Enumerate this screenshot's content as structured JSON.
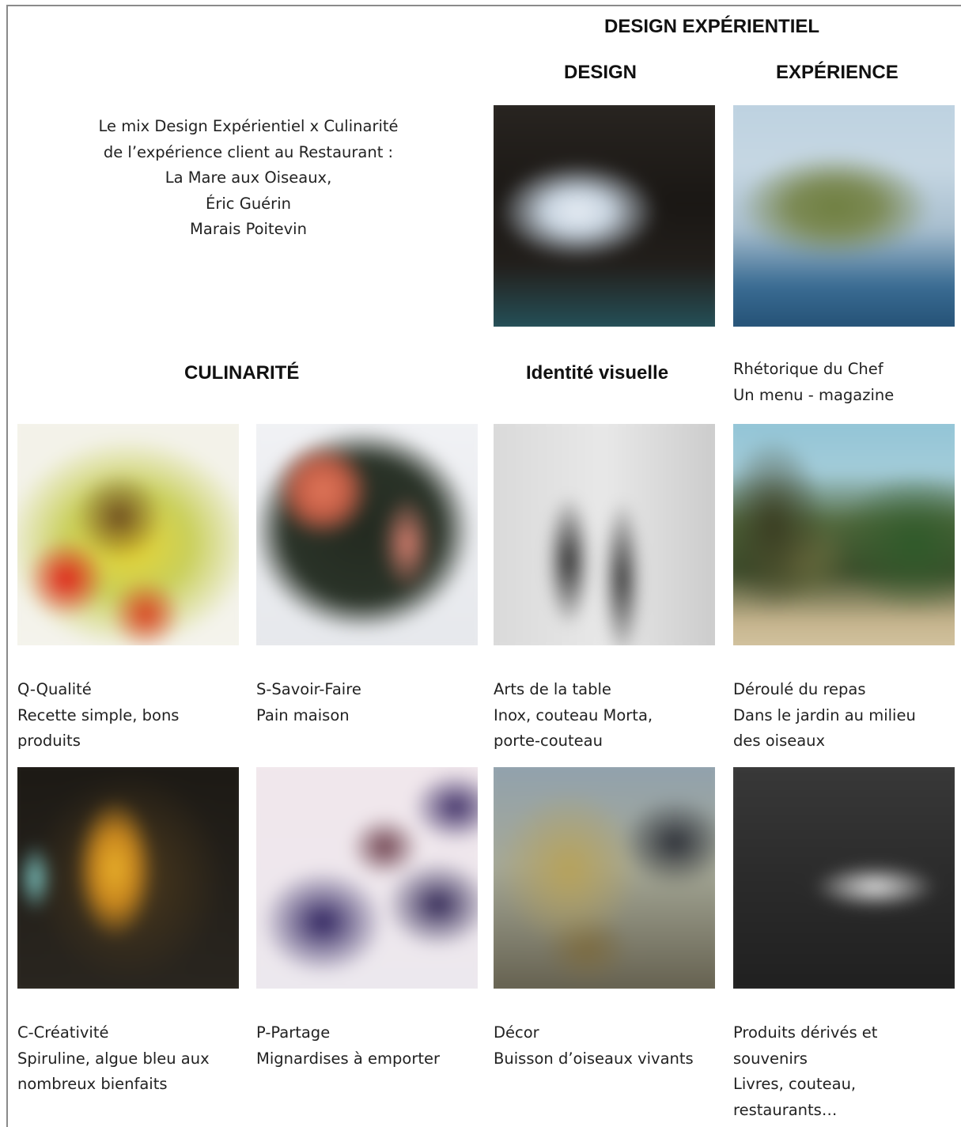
{
  "headings": {
    "design_experientiel": "DESIGN EXPÉRIENTIEL",
    "design": "DESIGN",
    "experience": "EXPÉRIENCE",
    "culinarite": "CULINARITÉ",
    "identite_visuelle": "Identité visuelle"
  },
  "intro": {
    "lines": [
      "Le mix Design Expérientiel x Culinarité",
      "de l’expérience client au Restaurant :",
      "La Mare aux Oiseaux,",
      "Éric Guérin",
      "Marais Poitevin"
    ]
  },
  "rhetorique": {
    "lines": [
      "Rhétorique du Chef",
      "Un menu - magazine"
    ]
  },
  "captions": {
    "qualite": [
      "Q-Qualité",
      "Recette simple, bons",
      "produits"
    ],
    "savoir_faire": [
      "S-Savoir-Faire",
      "Pain maison"
    ],
    "arts_table": [
      "Arts de la table",
      "Inox, couteau Morta,",
      "porte-couteau"
    ],
    "deroule": [
      "Déroulé du repas",
      "Dans le jardin au milieu",
      "des oiseaux"
    ],
    "creativite": [
      "C-Créativité",
      "Spiruline, algue bleu aux",
      "nombreux bienfaits"
    ],
    "partage": [
      "P-Partage",
      "Mignardises à emporter"
    ],
    "decor": [
      "Décor",
      "Buisson d’oiseaux vivants"
    ],
    "produits": [
      "Produits dérivés et",
      "souvenirs",
      "Livres, couteau,",
      "restaurants…"
    ]
  }
}
